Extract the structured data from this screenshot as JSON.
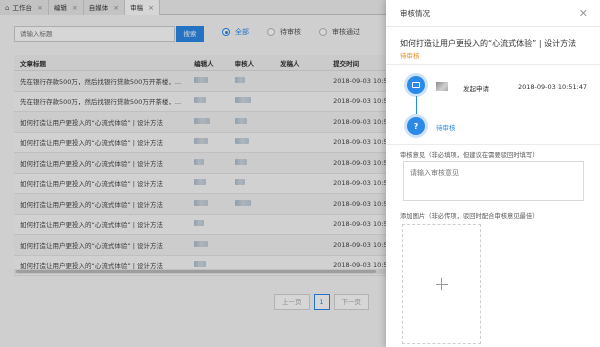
{
  "tabs": [
    {
      "label": "工作台",
      "active": false,
      "icon": "home-icon"
    },
    {
      "label": "编辑",
      "active": false
    },
    {
      "label": "自媒体",
      "active": false
    },
    {
      "label": "审稿",
      "active": true
    }
  ],
  "search": {
    "placeholder": "请输入标题",
    "button": "搜索"
  },
  "filters": [
    {
      "label": "全部",
      "selected": true
    },
    {
      "label": "待审核",
      "selected": false
    },
    {
      "label": "审核通过",
      "selected": false
    }
  ],
  "table": {
    "headers": [
      "文章标题",
      "编辑人",
      "审核人",
      "发稿人",
      "提交时间"
    ],
    "rows": [
      {
        "title": "先在银行存款500万，然后找银行贷款500万开茶楼，...",
        "time": "2018-09-03 10:5"
      },
      {
        "title": "先在银行存款500万，然后找银行贷款500万开茶楼，...",
        "time": "2018-09-03 10:5"
      },
      {
        "title": "如何打造让用户更投入的“心流式体验” | 设计方法",
        "time": "2018-09-03 10:5"
      },
      {
        "title": "如何打造让用户更投入的“心流式体验” | 设计方法",
        "time": "2018-09-03 10:5"
      },
      {
        "title": "如何打造让用户更投入的“心流式体验” | 设计方法",
        "time": "2018-09-03 10:5"
      },
      {
        "title": "如何打造让用户更投入的“心流式体验” | 设计方法",
        "time": "2018-09-03 10:5"
      },
      {
        "title": "如何打造让用户更投入的“心流式体验” | 设计方法",
        "time": "2018-09-03 10:5"
      },
      {
        "title": "如何打造让用户更投入的“心流式体验” | 设计方法",
        "time": "2018-09-03 10:5"
      },
      {
        "title": "如何打造让用户更投入的“心流式体验” | 设计方法",
        "time": "2018-09-03 10:5"
      },
      {
        "title": "如何打造让用户更投入的“心流式体验” | 设计方法",
        "time": "2018-09-03 10:5"
      }
    ]
  },
  "pagination": {
    "prev": "上一页",
    "current": "1",
    "next": "下一页"
  },
  "drawer": {
    "title": "审核情况",
    "article_title": "如何打造让用户更投入的“心流式体验” | 设计方法",
    "status": "待审核",
    "steps": [
      {
        "label": "发起申请",
        "time": "2018-09-03 10:51:47"
      },
      {
        "label": "待审核",
        "marker": "?"
      }
    ],
    "opinion_label": "审核意见（非必填项，但建议在需要驳回时填写）",
    "opinion_placeholder": "请输入审核意见",
    "image_label": "添加图片（非必传项，驳回时配合审核意见最佳）"
  },
  "colors": {
    "accent": "#2b89e8",
    "warning": "#e58e26"
  }
}
